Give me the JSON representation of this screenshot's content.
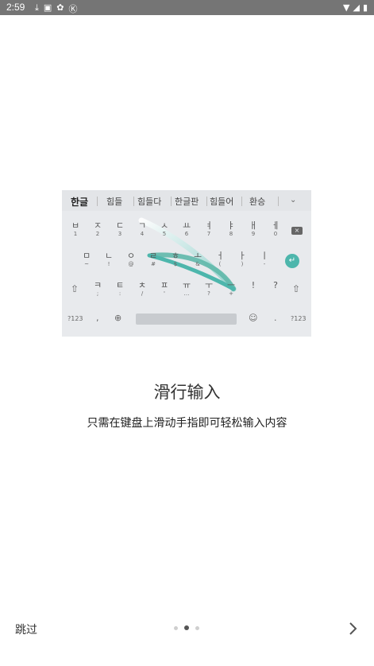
{
  "status_bar": {
    "time": "2:59",
    "left_icons": [
      "download-icon",
      "photo-icon",
      "settings-icon",
      "k-icon"
    ],
    "right_icons": [
      "wifi-icon",
      "signal-icon",
      "battery-icon"
    ]
  },
  "keyboard": {
    "suggestions": [
      "한글",
      "힘들",
      "힘들다",
      "한글판",
      "힘들어",
      "환승"
    ],
    "row1": [
      {
        "main": "ㅂ",
        "sub": "1"
      },
      {
        "main": "ㅈ",
        "sub": "2"
      },
      {
        "main": "ㄷ",
        "sub": "3"
      },
      {
        "main": "ㄱ",
        "sub": "4"
      },
      {
        "main": "ㅅ",
        "sub": "5"
      },
      {
        "main": "ㅛ",
        "sub": "6"
      },
      {
        "main": "ㅕ",
        "sub": "7"
      },
      {
        "main": "ㅑ",
        "sub": "8"
      },
      {
        "main": "ㅐ",
        "sub": "9"
      },
      {
        "main": "ㅔ",
        "sub": "0"
      }
    ],
    "row2": [
      {
        "main": "ㅁ",
        "sub": "~"
      },
      {
        "main": "ㄴ",
        "sub": "!"
      },
      {
        "main": "ㅇ",
        "sub": "@"
      },
      {
        "main": "ㄹ",
        "sub": "#"
      },
      {
        "main": "ㅎ",
        "sub": "$"
      },
      {
        "main": "ㅗ",
        "sub": "&"
      },
      {
        "main": "ㅓ",
        "sub": "("
      },
      {
        "main": "ㅏ",
        "sub": ")"
      },
      {
        "main": "ㅣ",
        "sub": "-"
      }
    ],
    "row3": [
      {
        "main": "ㅋ",
        "sub": ";"
      },
      {
        "main": "ㅌ",
        "sub": ":"
      },
      {
        "main": "ㅊ",
        "sub": "/"
      },
      {
        "main": "ㅍ",
        "sub": "'"
      },
      {
        "main": "ㅠ",
        "sub": "…"
      },
      {
        "main": "ㅜ",
        "sub": "?"
      },
      {
        "main": "ㅡ",
        "sub": "+"
      },
      {
        "main": "!",
        "sub": ""
      },
      {
        "main": "?",
        "sub": ""
      }
    ],
    "row4": {
      "symbols_left": "?123",
      "comma": ",",
      "period": ".",
      "symbols_right": "?123"
    },
    "accent_color": "#4db6ac"
  },
  "content": {
    "title": "滑行输入",
    "subtitle": "只需在键盘上滑动手指即可轻松输入内容"
  },
  "footer": {
    "skip_label": "跳过",
    "page_count": 3,
    "active_page": 2
  }
}
